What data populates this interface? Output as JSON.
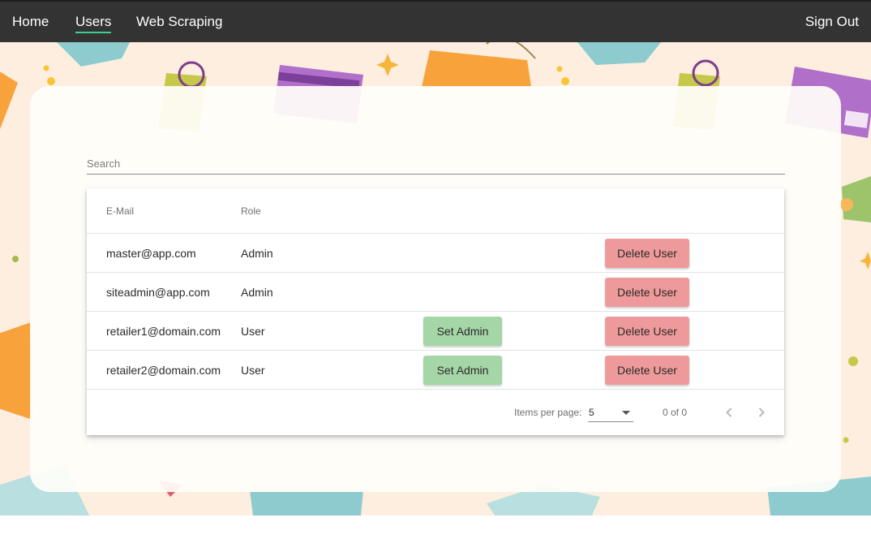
{
  "nav": {
    "home": "Home",
    "users": "Users",
    "web_scraping": "Web Scraping",
    "sign_out": "Sign Out",
    "active": "Users"
  },
  "search": {
    "placeholder": "Search",
    "value": ""
  },
  "table": {
    "headers": {
      "email": "E-Mail",
      "role": "Role"
    },
    "rows": [
      {
        "email": "master@app.com",
        "role": "Admin",
        "set_admin": "",
        "delete": "Delete User"
      },
      {
        "email": "siteadmin@app.com",
        "role": "Admin",
        "set_admin": "",
        "delete": "Delete User"
      },
      {
        "email": "retailer1@domain.com",
        "role": "User",
        "set_admin": "Set Admin",
        "delete": "Delete User"
      },
      {
        "email": "retailer2@domain.com",
        "role": "User",
        "set_admin": "Set Admin",
        "delete": "Delete User"
      }
    ]
  },
  "paginator": {
    "items_per_page_label": "Items per page:",
    "items_per_page_value": "5",
    "range": "0 of 0"
  },
  "icons": {
    "prev": "chevron-left-icon",
    "next": "chevron-right-icon",
    "dropdown": "caret-down-icon"
  },
  "colors": {
    "topbar": "#333333",
    "active_underline": "#3ecf8e",
    "set_admin_button": "#a5d6a7",
    "delete_button": "#ef9a9a",
    "background": "#fdeee0"
  }
}
